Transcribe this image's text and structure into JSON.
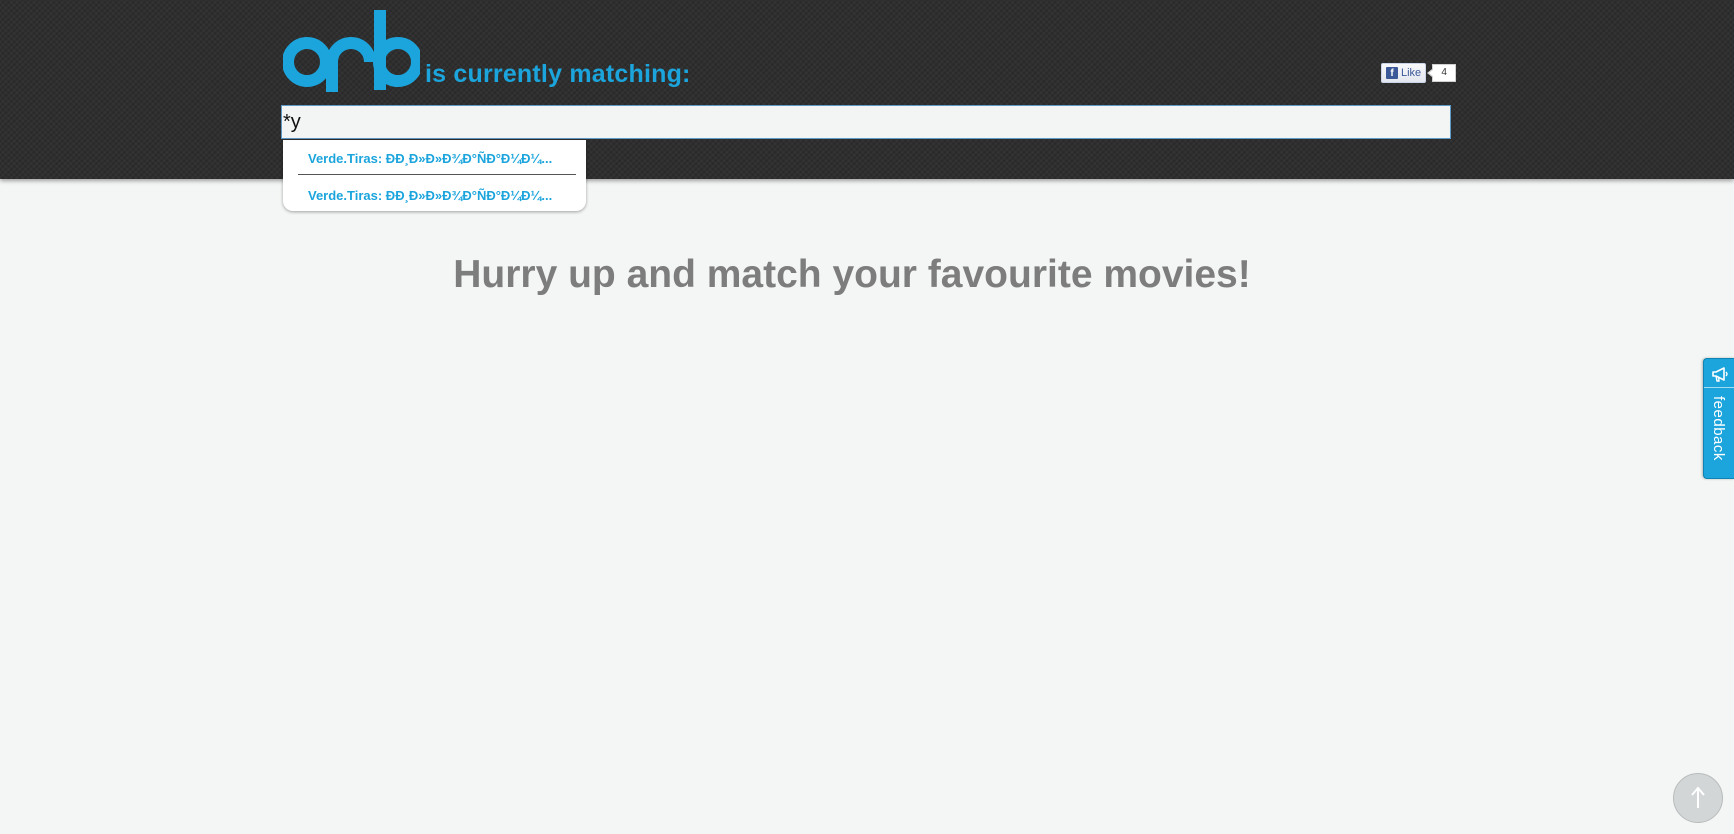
{
  "header": {
    "logo_text": "orb",
    "tagline": "is currently matching:",
    "fb_like": {
      "label": "Like",
      "count": "4"
    }
  },
  "search": {
    "value": "*y",
    "placeholder": ""
  },
  "suggestions": [
    {
      "label": "Verde.Tiras: ÐÐ¸Ð»Ð»Ð¾Ð°ÑÐ°Ð¼Ð¼..."
    },
    {
      "label": "Verde.Tiras: ÐÐ¸Ð»Ð»Ð¾Ð°ÑÐ°Ð¼Ð¼..."
    }
  ],
  "main": {
    "headline": "Hurry up and match your favourite movies!"
  },
  "feedback": {
    "label": "feedback",
    "icon": "megaphone-icon"
  },
  "scroll_top": {
    "icon": "arrow-up-icon"
  },
  "colors": {
    "accent": "#1ba5dc",
    "header_bg": "#2f2f2f",
    "page_bg": "#f4f6f5",
    "headline": "#7d7d7d"
  }
}
